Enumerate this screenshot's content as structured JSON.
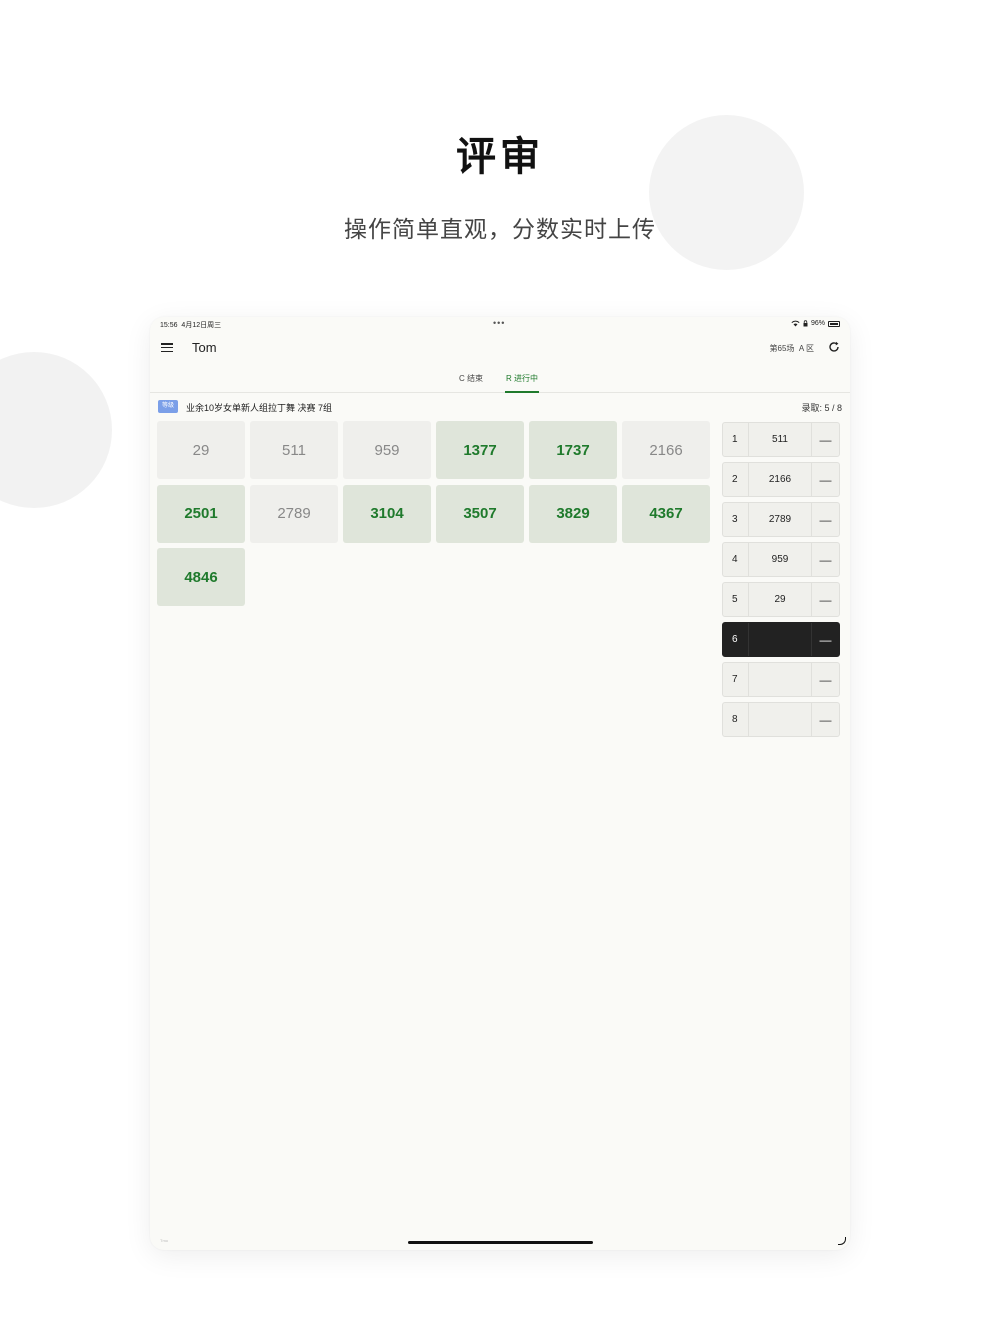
{
  "hero": {
    "title": "评审",
    "subtitle": "操作简单直观，分数实时上传"
  },
  "statusbar": {
    "time": "15:56",
    "date": "4月12日周三",
    "dots": "•••",
    "battery": "96%"
  },
  "appbar": {
    "user": "Tom",
    "round": "第65场",
    "zone": "A 区"
  },
  "tabs": [
    {
      "label": "C  结束",
      "active": false
    },
    {
      "label": "R  进行中",
      "active": true
    }
  ],
  "group": {
    "badge": "等级",
    "title": "业余10岁女单新人组拉丁舞 决赛 7组",
    "quota": "录取: 5 / 8"
  },
  "tiles": [
    {
      "number": "29",
      "selected": false
    },
    {
      "number": "511",
      "selected": false
    },
    {
      "number": "959",
      "selected": false
    },
    {
      "number": "1377",
      "selected": true
    },
    {
      "number": "1737",
      "selected": true
    },
    {
      "number": "2166",
      "selected": false
    },
    {
      "number": "2501",
      "selected": true
    },
    {
      "number": "2789",
      "selected": false
    },
    {
      "number": "3104",
      "selected": true
    },
    {
      "number": "3507",
      "selected": true
    },
    {
      "number": "3829",
      "selected": true
    },
    {
      "number": "4367",
      "selected": true
    },
    {
      "number": "4846",
      "selected": true
    }
  ],
  "ranking": [
    {
      "rank": "1",
      "value": "511",
      "remove": "—"
    },
    {
      "rank": "2",
      "value": "2166",
      "remove": "—"
    },
    {
      "rank": "3",
      "value": "2789",
      "remove": "—"
    },
    {
      "rank": "4",
      "value": "959",
      "remove": "—"
    },
    {
      "rank": "5",
      "value": "29",
      "remove": "—"
    },
    {
      "rank": "6",
      "value": "",
      "remove": "—",
      "active": true
    },
    {
      "rank": "7",
      "value": "",
      "remove": "—"
    },
    {
      "rank": "8",
      "value": "",
      "remove": "—"
    }
  ],
  "footer": {
    "text": "Tmo"
  },
  "colors": {
    "accent_green": "#1f7a2c",
    "selected_tile_bg": "#dfe5da",
    "badge_blue": "#7b9fe8",
    "active_row_bg": "#222222"
  }
}
